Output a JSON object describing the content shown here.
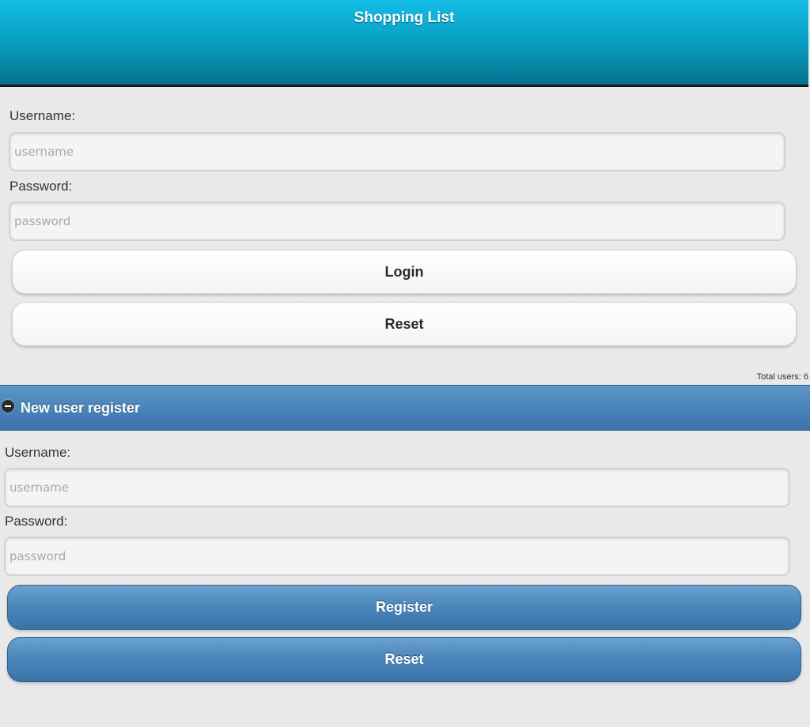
{
  "header": {
    "title": "Shopping List"
  },
  "login": {
    "username_label": "Username:",
    "username_placeholder": "username",
    "password_label": "Password:",
    "password_placeholder": "password",
    "login_button": "Login",
    "reset_button": "Reset"
  },
  "status": {
    "total_users": "Total users: 6"
  },
  "register": {
    "section_title": "New user register",
    "section_icon": "minus-circle-icon",
    "username_label": "Username:",
    "username_placeholder": "username",
    "password_label": "Password:",
    "password_placeholder": "password",
    "register_button": "Register",
    "reset_button": "Reset"
  },
  "colors": {
    "header_accent": "#0aa2c6",
    "collapsible_accent": "#4a84b9"
  }
}
